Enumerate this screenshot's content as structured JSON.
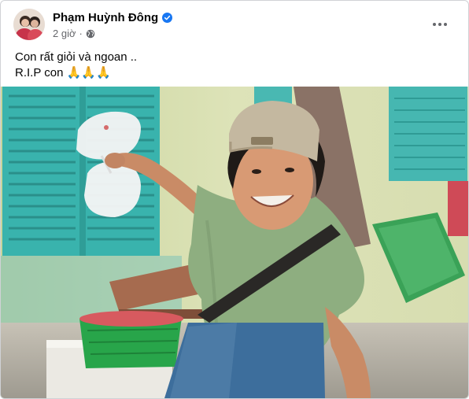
{
  "post": {
    "author": "Phạm Huỳnh Đông",
    "timestamp": "2 giờ",
    "audience_icon": "globe-icon",
    "verified_icon": "verified-badge-icon",
    "more_icon": "more-options-icon",
    "text_lines": [
      "Con rất giỏi và ngoan ..",
      "R.I.P con 🙏🙏🙏"
    ]
  },
  "colors": {
    "verified": "#1877f2",
    "secondary_text": "#65676b",
    "wall": "#cfd8a8",
    "shutter": "#3fb6b4",
    "shirt": "#8fae7e"
  }
}
